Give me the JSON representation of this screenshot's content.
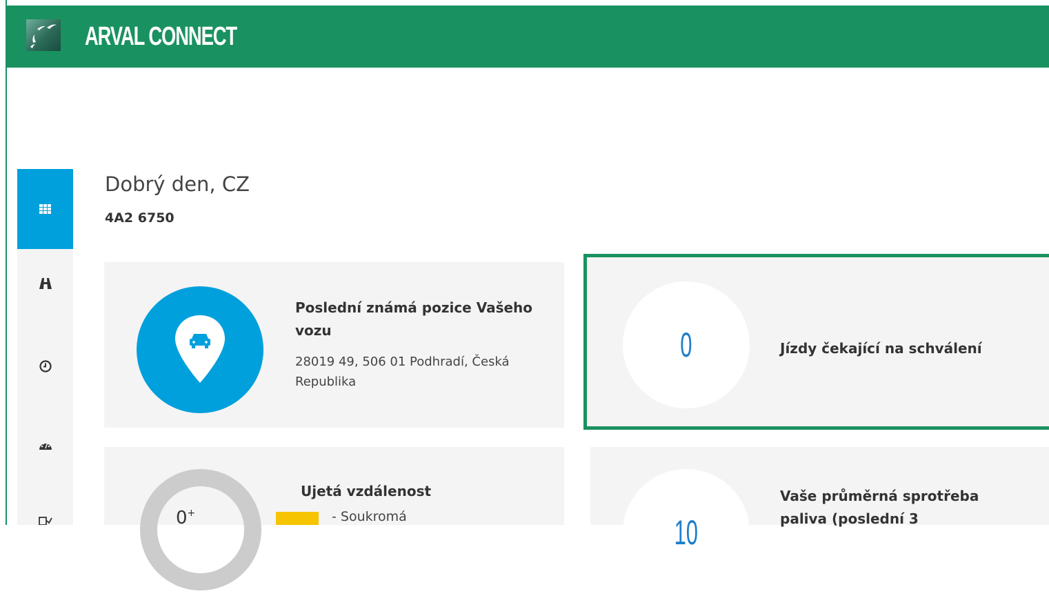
{
  "header": {
    "brand": "ARVAL CONNECT",
    "logo_icon": "bnp-stars-logo-icon",
    "color": "#1a9160"
  },
  "sidebar": {
    "accent": "#00a0dc",
    "items": [
      {
        "icon": "dashboard-grid-icon",
        "active": true
      },
      {
        "icon": "road-icon",
        "active": false
      },
      {
        "icon": "clock-icon",
        "active": false
      },
      {
        "icon": "speedometer-icon",
        "active": false
      },
      {
        "icon": "checklist-icon",
        "active": false
      }
    ]
  },
  "greeting": {
    "text": "Dobrý den, CZ",
    "plate": "4A2 6750"
  },
  "cards": {
    "position": {
      "title": "Poslední známá pozice Vašeho vozu",
      "address": "28019 49, 506 01 Podhradí, Česká Republika",
      "icon": "car-location-pin-icon"
    },
    "pending_trips": {
      "value": "0",
      "label": "Jízdy čekající na schválení"
    },
    "distance": {
      "value": "0",
      "value_suffix": "+",
      "title": "Ujetá vzdálenost",
      "legend": [
        {
          "label": "- Soukromá",
          "color": "#f6c400"
        }
      ]
    },
    "fuel": {
      "value": "10",
      "title": "Vaše průměrná sprotřeba paliva (poslední 3"
    }
  }
}
